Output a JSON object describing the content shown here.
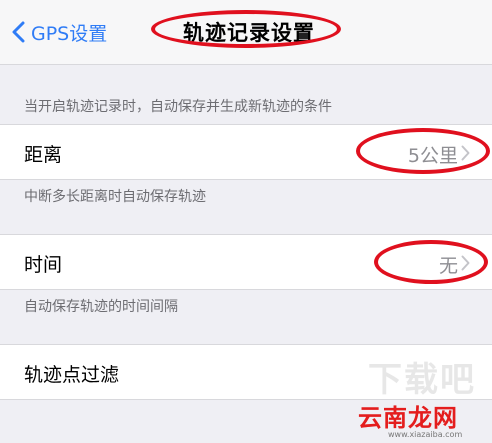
{
  "nav": {
    "back_label": "GPS设置",
    "title": "轨迹记录设置"
  },
  "section1": {
    "header": "当开启轨迹记录时，自动保存并生成新轨迹的条件"
  },
  "distance_cell": {
    "label": "距离",
    "value": "5公里",
    "footer": "中断多长距离时自动保存轨迹"
  },
  "time_cell": {
    "label": "时间",
    "value": "无",
    "footer": "自动保存轨迹的时间间隔"
  },
  "filter_cell": {
    "label": "轨迹点过滤"
  },
  "watermark": {
    "brand": "云南龙网",
    "url": "www.xiazaiba.com",
    "ghost": "下载吧"
  },
  "colors": {
    "accent": "#2f7cf6",
    "annotation_ring": "#e0101e",
    "secondary_text": "#8e8e93"
  }
}
